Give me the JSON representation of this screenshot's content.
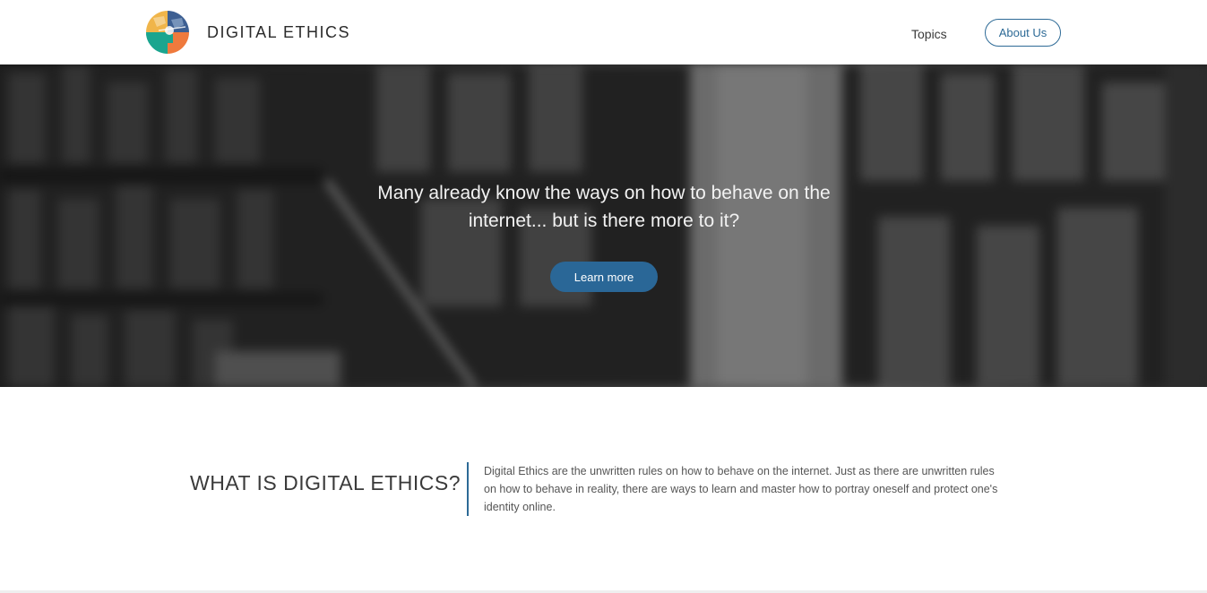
{
  "header": {
    "brand": "DIGITAL ETHICS",
    "nav": {
      "topics": "Topics",
      "about": "About Us"
    }
  },
  "hero": {
    "line1": "Many already know the ways on how to behave on the",
    "line2": "internet... but is there more to it?",
    "button_label": "Learn more"
  },
  "about": {
    "heading": "WHAT IS DIGITAL ETHICS?",
    "text": "Digital Ethics are the unwritten rules on how to behave on the internet. Just as there are unwritten rules on how to behave in reality, there are ways to learn and master how to portray oneself and protect one's identity online."
  },
  "colors": {
    "accent": "#2d6a96",
    "button": "#2a6797"
  }
}
